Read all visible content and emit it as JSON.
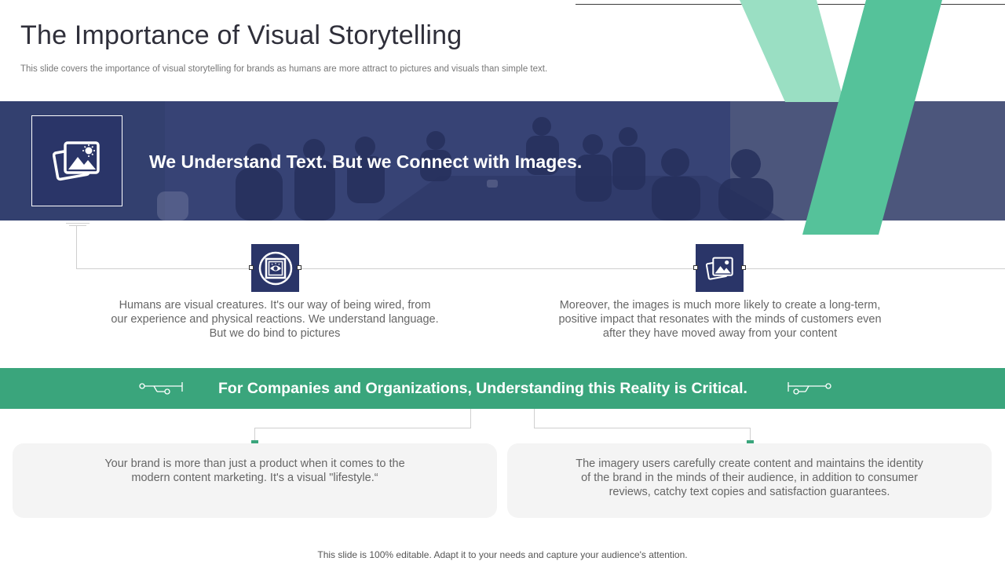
{
  "header": {
    "title": "The Importance of Visual Storytelling",
    "subtitle": "This slide covers the importance of visual storytelling for brands as humans are more attract to pictures and visuals than simple text."
  },
  "banner": {
    "heading": "We Understand Text. But we Connect with Images.",
    "icon": "photos-icon"
  },
  "points": [
    {
      "icon": "eye-frame-icon",
      "text": "Humans are visual creatures. It's our way of being wired, from our experience and physical reactions. We understand language.  But we do bind to pictures"
    },
    {
      "icon": "photos-icon",
      "text": "Moreover,  the images is much more likely  to create a long-term, positive impact that resonates with the minds of customers even after they have moved away from your content"
    }
  ],
  "callout": {
    "heading": "For Companies and Organizations, Understanding this Reality is Critical."
  },
  "cards": [
    {
      "text": "Your brand is more than just a product when it comes to the modern content marketing. It's a visual \"lifestyle.“"
    },
    {
      "text": "The imagery users carefully create content and maintains the identity of the brand in the minds of their audience, in addition to consumer reviews, catchy text copies and satisfaction guarantees."
    }
  ],
  "footer": "This slide is 100% editable. Adapt it to your needs and capture your audience's attention.",
  "colors": {
    "navy": "#2a3568",
    "green": "#3aa57c",
    "mint": "#5cc59c",
    "mint_light": "#9adfc3"
  }
}
